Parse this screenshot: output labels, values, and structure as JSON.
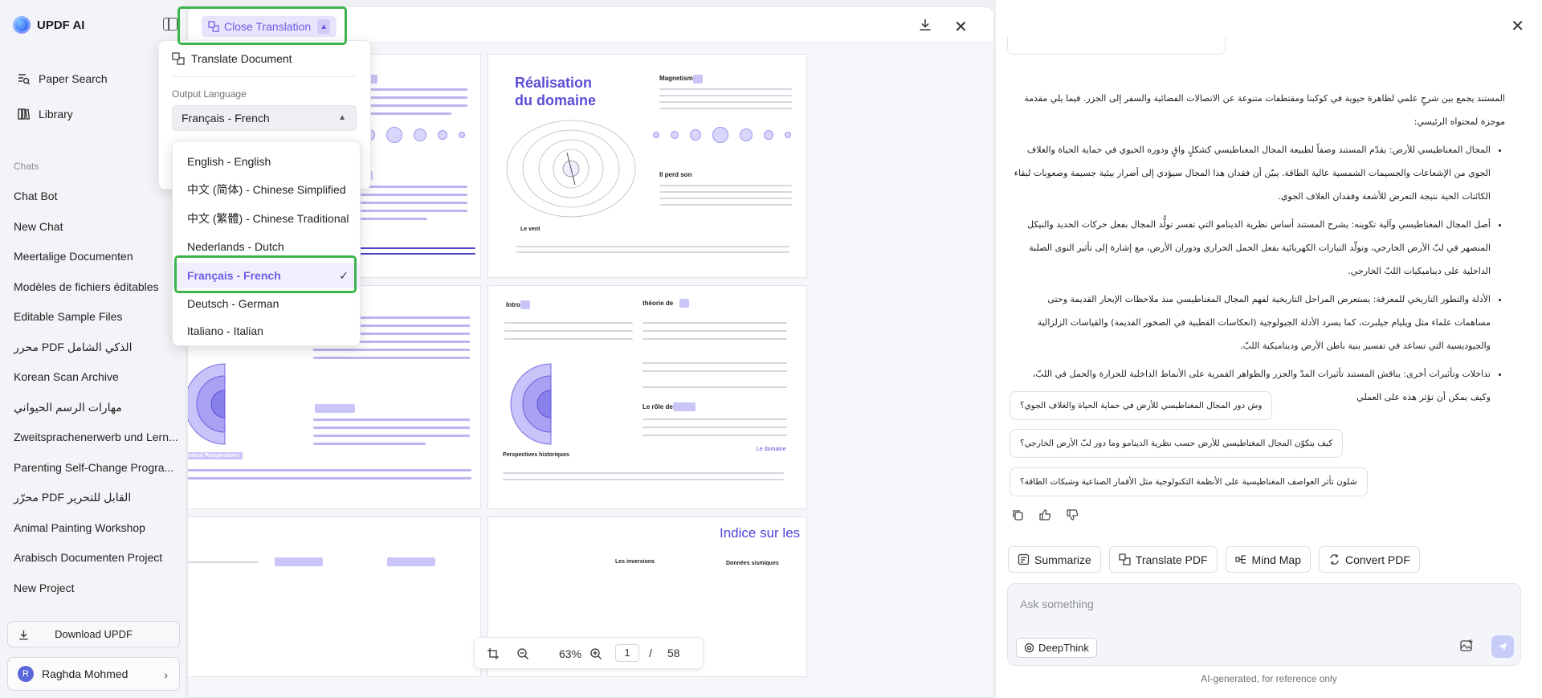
{
  "sidebar": {
    "brand": "UPDF AI",
    "nav": [
      {
        "label": "Paper Search",
        "icon": "paper-search-icon"
      },
      {
        "label": "Library",
        "icon": "library-icon"
      }
    ],
    "chats_header": "Chats",
    "chats": [
      "Chat Bot",
      "New Chat",
      "Meertalige Documenten",
      "Modèles de fichiers éditables",
      "Editable Sample Files",
      "محرر PDF الذكي الشامل",
      "Korean Scan Archive",
      "مهارات الرسم الحيواني",
      "Zweitsprachenerwerb und Lern...",
      "Parenting Self-Change Progra...",
      "محرّر PDF القابل للتحرير",
      "Animal Painting Workshop",
      "Arabisch Documenten Project",
      "New Project"
    ],
    "download_label": "Download UPDF",
    "user": {
      "initial": "R",
      "name": "Raghda Mohmed"
    }
  },
  "viewer": {
    "close_translation": "Close Translation",
    "page_titles": {
      "p2_title_line1": "Réalisation",
      "p2_title_line2": "du domaine",
      "p2_magnetisme": "Magnetisme",
      "p2_il_perd_son": "Il perd son",
      "p2_le_vent": "Le vent",
      "p4_intro": "Intro",
      "p4_theorie": "théorie de",
      "p4_le_role": "Le rôle de",
      "p4_perspectives": "Perspectives historiques",
      "p4_le_domaine": "Le domaine",
      "p3_historical": "Historical Perspectives",
      "p6_indice": "Indice sur les",
      "p6_inversions": "Les inversions",
      "p6_donnees": "Données sismiques"
    },
    "zoom": "63%",
    "current_page": "1",
    "page_separator": "/",
    "total_pages": "58"
  },
  "dropdown": {
    "translate_document": "Translate Document",
    "output_language_label": "Output Language",
    "selected_language": "Français - French",
    "languages": [
      {
        "label": "English - English",
        "selected": false
      },
      {
        "label": "中文 (简体) - Chinese Simplified",
        "selected": false
      },
      {
        "label": "中文 (繁體) - Chinese Traditional",
        "selected": false
      },
      {
        "label": "Nederlands - Dutch",
        "selected": false
      },
      {
        "label": "Français - French",
        "selected": true
      },
      {
        "label": "Deutsch - German",
        "selected": false
      },
      {
        "label": "Italiano - Italian",
        "selected": false
      }
    ]
  },
  "chat": {
    "intro": "المستند يجمع بين شرحٍ علمي لظاهرة حيوية في كوكبنا ومقتطفات متنوعة عن الاتصالات الفضائية والسفر إلى الجزر. فيما يلي مقدمة موجزة لمحتواه الرئيسي:",
    "bullets": [
      "المجال المغناطيسي للأرض: يقدّم المستند وصفاً لطبيعة المجال المغناطيسي كشكلٍ واقٍ ودوره الحيوي في حماية الحياة والغلاف الجوي من الإشعاعات والجسيمات الشمسية عالية الطاقة. يبيّن أن فقدان هذا المجال سيؤدي إلى أضرار بيئية جسيمة وصعوبات لبقاء الكائنات الحية نتيجة التعرض للأشعة وفقدان الغلاف الجوي.",
      "أصل المجال المغناطيسي وآلية تكوينه: يشرح المستند أساس نظرية الدينامو التي تفسر تولُّد المجال بفعل حركات الحديد والنيكل المنصهر في لبّ الأرض الخارجي، وتولّد التيارات الكهربائية بفعل الحمل الحراري ودوران الأرض، مع إشارة إلى تأثير النوى الصلبة الداخلية على ديناميكيات اللبّ الخارجي.",
      "الأدلة والتطور التاريخي للمعرفة: يستعرض المراحل التاريخية لفهم المجال المغناطيسي منذ ملاحظات الإبحار القديمة وحتى مساهمات علماء مثل ويليام جيلبرت، كما يسرد الأدلة الجيولوجية (انعكاسات القطبية في الصخور القديمة) والقياسات الزلزالية والجيوديسية التي تساعد في تفسير بنية باطن الأرض وديناميكية اللبّ.",
      "تداخلات وتأثيرات أخرى: يناقش المستند تأثيرات المدّ والجزر والظواهر القمرية على الأنماط الداخلية للحرارة والحمل في اللبّ، وكيف يمكن أن تؤثر هذه على العملي"
    ],
    "suggestions": [
      "وش دور المجال المغناطيسي للأرض في حماية الحياة والغلاف الجوي؟",
      "كيف يتكوّن المجال المغناطيسي للأرض حسب نظرية الدينامو وما دور لبّ الأرض الخارجي؟",
      "شلون تأثر العواصف المغناطيسية على الأنظمة التكنولوجية مثل الأقمار الصناعية وشبكات الطاقة؟"
    ],
    "actions": [
      "Summarize",
      "Translate PDF",
      "Mind Map",
      "Convert PDF"
    ],
    "ask_placeholder": "Ask something",
    "deepthink": "DeepThink",
    "disclaimer": "AI-generated, for reference only"
  }
}
